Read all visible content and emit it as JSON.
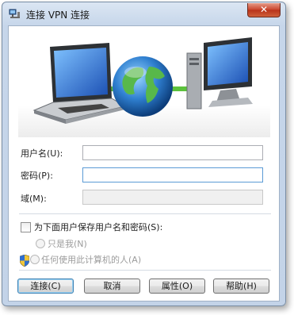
{
  "window": {
    "title": "连接 VPN 连接",
    "close_glyph": "✕"
  },
  "form": {
    "username_label": "用户名(U):",
    "username_value": "",
    "password_label": "密码(P):",
    "password_value": "",
    "domain_label": "域(M):",
    "domain_value": ""
  },
  "save": {
    "checkbox_label": "为下面用户保存用户名和密码(S):",
    "checked": false,
    "option_me": "只是我(N)",
    "option_anyone": "任何使用此计算机的人(A)"
  },
  "buttons": {
    "connect": "连接(C)",
    "cancel": "取消",
    "properties": "属性(O)",
    "help": "帮助(H)"
  },
  "icons": {
    "title": "network-connection-icon",
    "banner": [
      "laptop-icon",
      "globe-icon",
      "server-icon"
    ],
    "shield": "uac-shield-icon"
  }
}
